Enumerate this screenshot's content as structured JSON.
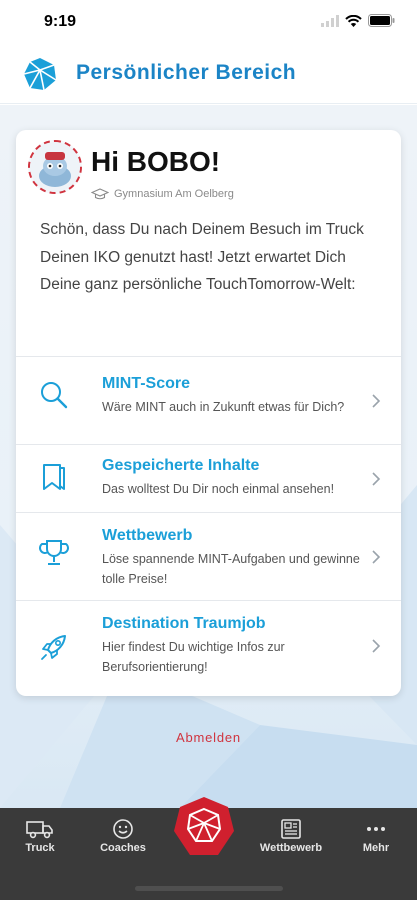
{
  "status_bar": {
    "time": "9:19"
  },
  "header": {
    "title": "Persönlicher Bereich"
  },
  "profile": {
    "greeting": "Hi BOBO!",
    "school": "Gymnasium Am Oelberg"
  },
  "welcome_text": "Schön, dass Du nach Deinem Besuch im Truck Deinen IKO genutzt hast! Jetzt erwartet Dich Deine ganz persönliche TouchTomorrow-Welt:",
  "menu": [
    {
      "title": "MINT-Score",
      "desc": "Wäre MINT auch in Zukunft etwas für Dich?",
      "icon": "search-icon"
    },
    {
      "title": "Gespeicherte Inhalte",
      "desc": "Das wolltest Du Dir noch einmal ansehen!",
      "icon": "bookmark-icon"
    },
    {
      "title": "Wettbewerb",
      "desc": "Löse spannende MINT-Aufgaben und gewinne tolle Preise!",
      "icon": "trophy-icon"
    },
    {
      "title": "Destination Traumjob",
      "desc": "Hier findest Du wichtige Infos zur Berufsorientierung!",
      "icon": "rocket-icon"
    }
  ],
  "logout_label": "Abmelden",
  "tabbar": {
    "items": [
      {
        "label": "Truck",
        "icon": "truck-icon"
      },
      {
        "label": "Coaches",
        "icon": "smiley-icon"
      },
      {
        "label": "Wettbewerb",
        "icon": "newspaper-icon"
      },
      {
        "label": "Mehr",
        "icon": "more-dots-icon"
      }
    ],
    "center_icon": "logo-gem-icon"
  },
  "colors": {
    "accent_blue": "#1b9fd8",
    "title_blue": "#1b84c6",
    "logout_red": "#d0343f",
    "tabbar_bg": "#3a3a3a"
  }
}
